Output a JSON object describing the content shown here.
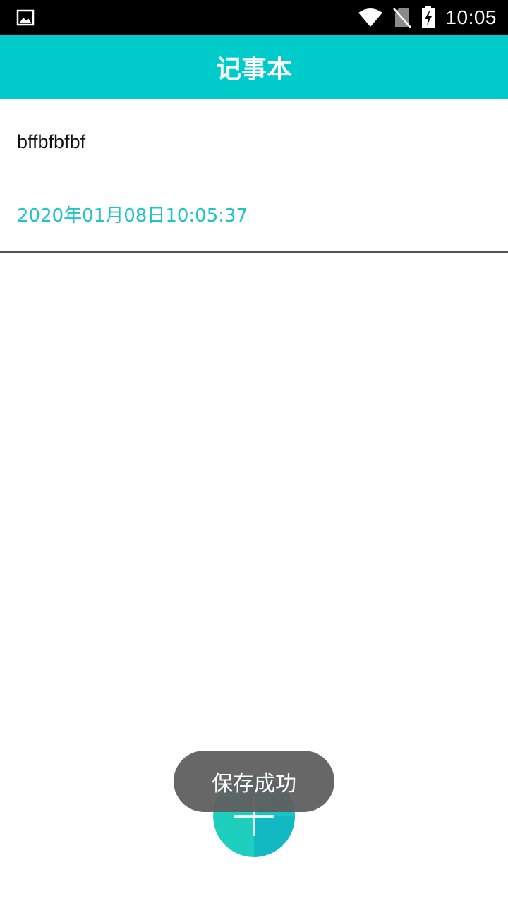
{
  "status_bar": {
    "time": "10:05",
    "icons": [
      "image-icon",
      "wifi-icon",
      "no-sim-icon",
      "battery-charging-icon"
    ]
  },
  "app_bar": {
    "title": "记事本"
  },
  "notes": [
    {
      "content": "bffbfbfbf",
      "time": "2020年01月08日10:05:37"
    }
  ],
  "fab": {
    "icon": "add-icon"
  },
  "toast": {
    "message": "保存成功"
  },
  "colors": {
    "primary": "#00cbcb",
    "timestamp": "#1fc3c8",
    "toast_bg": "#5f5f5f",
    "status_bar_bg": "#000000"
  }
}
